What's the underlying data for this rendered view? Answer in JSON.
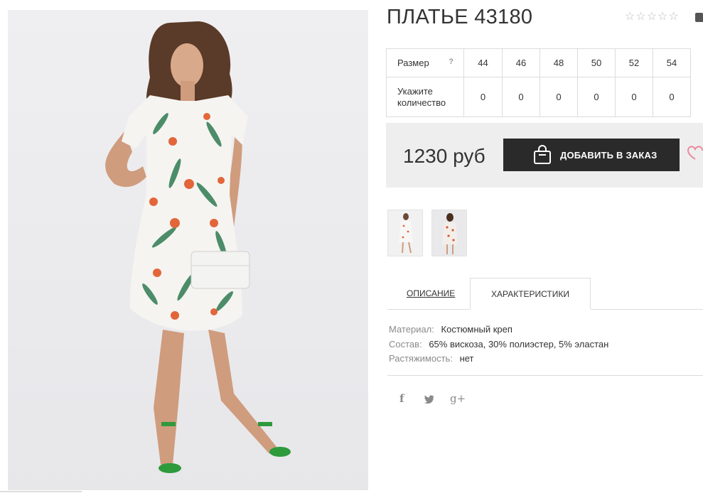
{
  "product": {
    "title": "ПЛАТЬЕ 43180",
    "rating": {
      "stars_filled": 0,
      "stars_total": 5
    }
  },
  "size_table": {
    "size_label": "Размер",
    "help": "?",
    "qty_label_line1": "Укажите",
    "qty_label_line2": "количество",
    "sizes": [
      "44",
      "46",
      "48",
      "50",
      "52",
      "54"
    ],
    "quantities": [
      "0",
      "0",
      "0",
      "0",
      "0",
      "0"
    ]
  },
  "buy": {
    "price": "1230 руб",
    "add_button_label": "ДОБАВИТЬ В ЗАКАЗ",
    "bag_icon": "shopping-bag-icon",
    "favorite_icon": "heart-icon"
  },
  "tabs": {
    "description": "ОПИСАНИЕ",
    "specs": "ХАРАКТЕРИСТИКИ",
    "active": "specs"
  },
  "specs": [
    {
      "key": "Материал:",
      "value": "Костюмный креп"
    },
    {
      "key": "Состав:",
      "value": "65% вискоза, 30% полиэстер, 5% эластан"
    },
    {
      "key": "Растяжимость:",
      "value": "нет"
    }
  ],
  "social": {
    "facebook": "f",
    "twitter": "twitter-icon",
    "google_plus": "g+"
  },
  "colors": {
    "dark_button": "#2a2a2a",
    "panel_bg": "#eeeeef",
    "heart": "#e98a9c",
    "shoe_green": "#2e9a3c",
    "flower_orange": "#e2663a",
    "leaf_green": "#2f7a52"
  }
}
